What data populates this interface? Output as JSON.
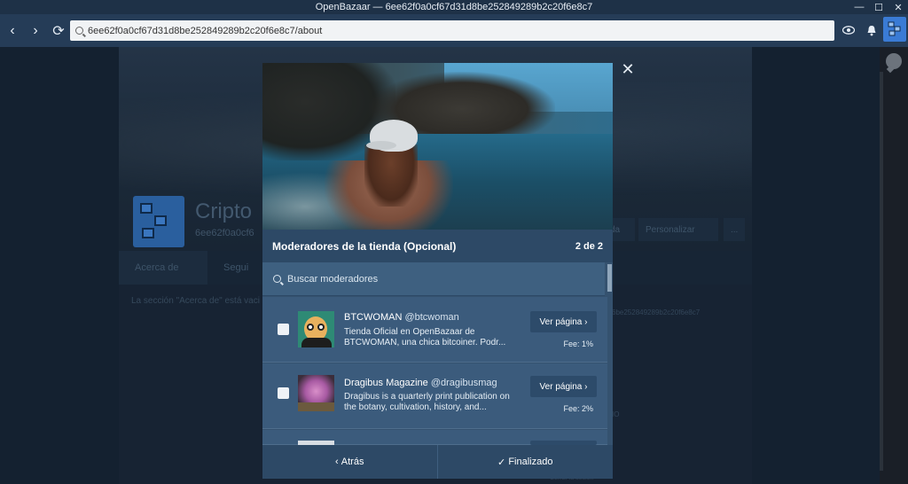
{
  "window": {
    "title": "OpenBazaar — 6ee62f0a0cf67d31d8be252849289b2c20f6e8c7",
    "controls": [
      "—",
      "☐",
      "✕"
    ]
  },
  "nav": {
    "back_icon": "‹",
    "forward_icon": "›",
    "reload_icon": "⟳",
    "url": "6ee62f0a0cf67d31d8be252849289b2c20f6e8c7/about",
    "right_icons": [
      "eye-icon",
      "bell-icon",
      "avatar-icon"
    ]
  },
  "background": {
    "store_name": "Cripto",
    "store_id": "6ee62f0a0cf6",
    "actions": [
      "da",
      "Personalizar",
      "..."
    ],
    "tabs": [
      "Acerca de",
      "Segui"
    ],
    "about_text": "La sección \"Acerca de\" está vaci",
    "side_id": "6be252849289b2c20f6e8c7",
    "side_label": "IO",
    "footer_small": "Cerrar la sesión"
  },
  "modal": {
    "close_icon": "✕",
    "title": "Moderadores de la tienda (Opcional)",
    "steps": "2 de 2",
    "search_placeholder": "Buscar moderadores",
    "moderators": [
      {
        "name": "BTCWOMAN",
        "handle": "@btcwoman",
        "description": "Tienda Oficial en OpenBazaar de BTCWOMAN, una chica bitcoiner. Podr...",
        "button": "Ver página",
        "fee": "Fee: 1%"
      },
      {
        "name": "Dragibus Magazine",
        "handle": "@dragibusmag",
        "description": "Dragibus is a quarterly print publication on the botany, cultivation, history, and...",
        "button": "Ver página",
        "fee": "Fee: 2%"
      }
    ],
    "back_label": "Atrás",
    "done_label": "Finalizado"
  }
}
